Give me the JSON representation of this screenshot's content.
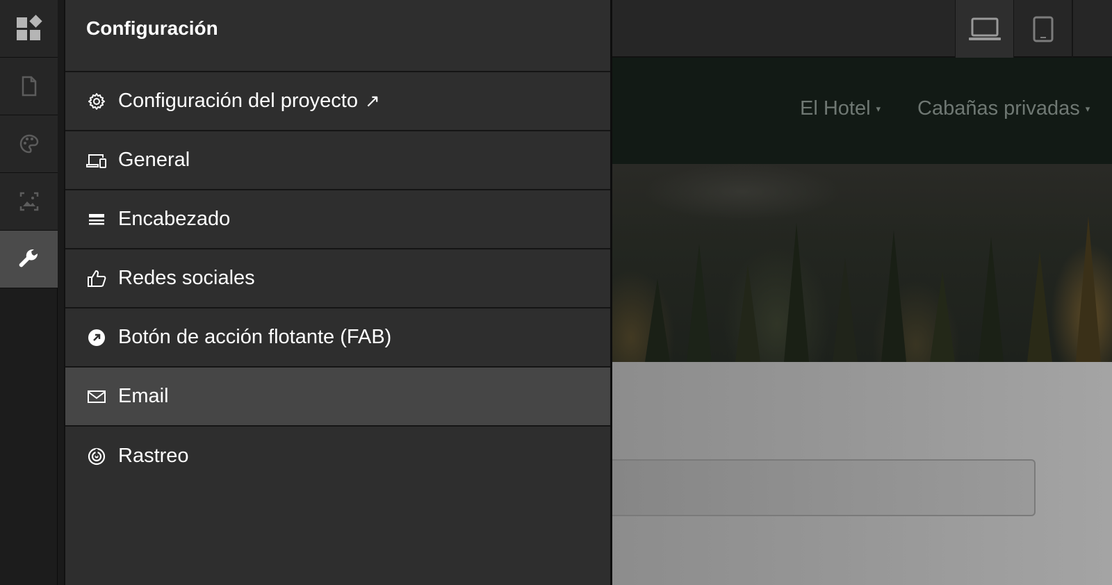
{
  "rail": {
    "items": [
      {
        "icon": "blocks-icon"
      },
      {
        "icon": "page-icon"
      },
      {
        "icon": "palette-icon"
      },
      {
        "icon": "image-icon"
      },
      {
        "icon": "wrench-icon",
        "active": true
      }
    ]
  },
  "panel": {
    "title": "Configuración",
    "items": [
      {
        "icon": "gear-icon",
        "label": "Configuración del proyecto",
        "external": "↗"
      },
      {
        "icon": "devices-icon",
        "label": "General"
      },
      {
        "icon": "header-icon",
        "label": "Encabezado"
      },
      {
        "icon": "thumbs-up-icon",
        "label": "Redes sociales"
      },
      {
        "icon": "fab-arrow-icon",
        "label": "Botón de acción flotante (FAB)"
      },
      {
        "icon": "mail-icon",
        "label": "Email",
        "highlighted": true
      },
      {
        "icon": "radar-icon",
        "label": "Rastreo"
      }
    ]
  },
  "toolbar": {
    "devices": [
      {
        "icon": "laptop-icon",
        "selected": true
      },
      {
        "icon": "tablet-icon"
      }
    ]
  },
  "site": {
    "nav": [
      {
        "label": "El Hotel",
        "caret": "▾"
      },
      {
        "label": "Cabañas privadas",
        "caret": "▾"
      }
    ]
  },
  "colors": {
    "panel_bg": "#2e2e2e",
    "highlight": "#464646",
    "rail_active": "#4b4b4b",
    "site_nav_bg": "#121a15"
  }
}
